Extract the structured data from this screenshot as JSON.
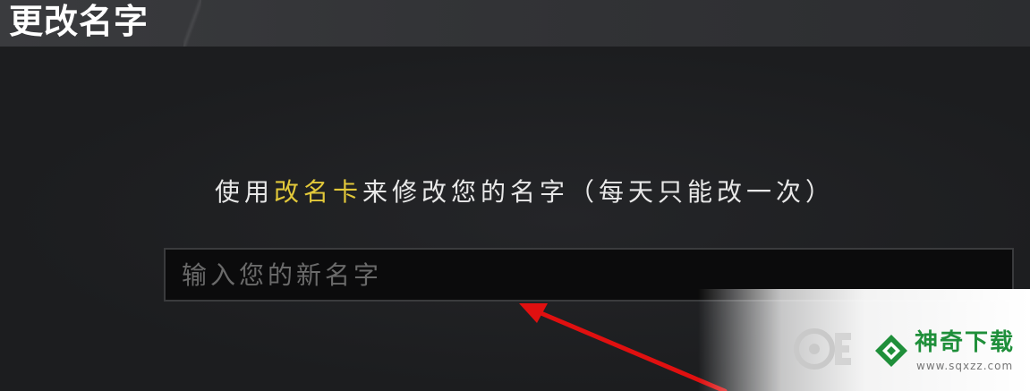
{
  "header": {
    "title": "更改名字"
  },
  "dialog": {
    "instruction_prefix": "使用",
    "instruction_highlight": "改名卡",
    "instruction_suffix": "来修改您的名字（每天只能改一次）",
    "highlight_color": "#e2c83a",
    "input_placeholder": "输入您的新名字",
    "input_value": ""
  },
  "watermark": {
    "brand": "神奇下载",
    "url": "www.sqxzz.com",
    "brand_color": "#1f8f3a"
  },
  "annotation": {
    "arrow_color": "#e01010"
  }
}
